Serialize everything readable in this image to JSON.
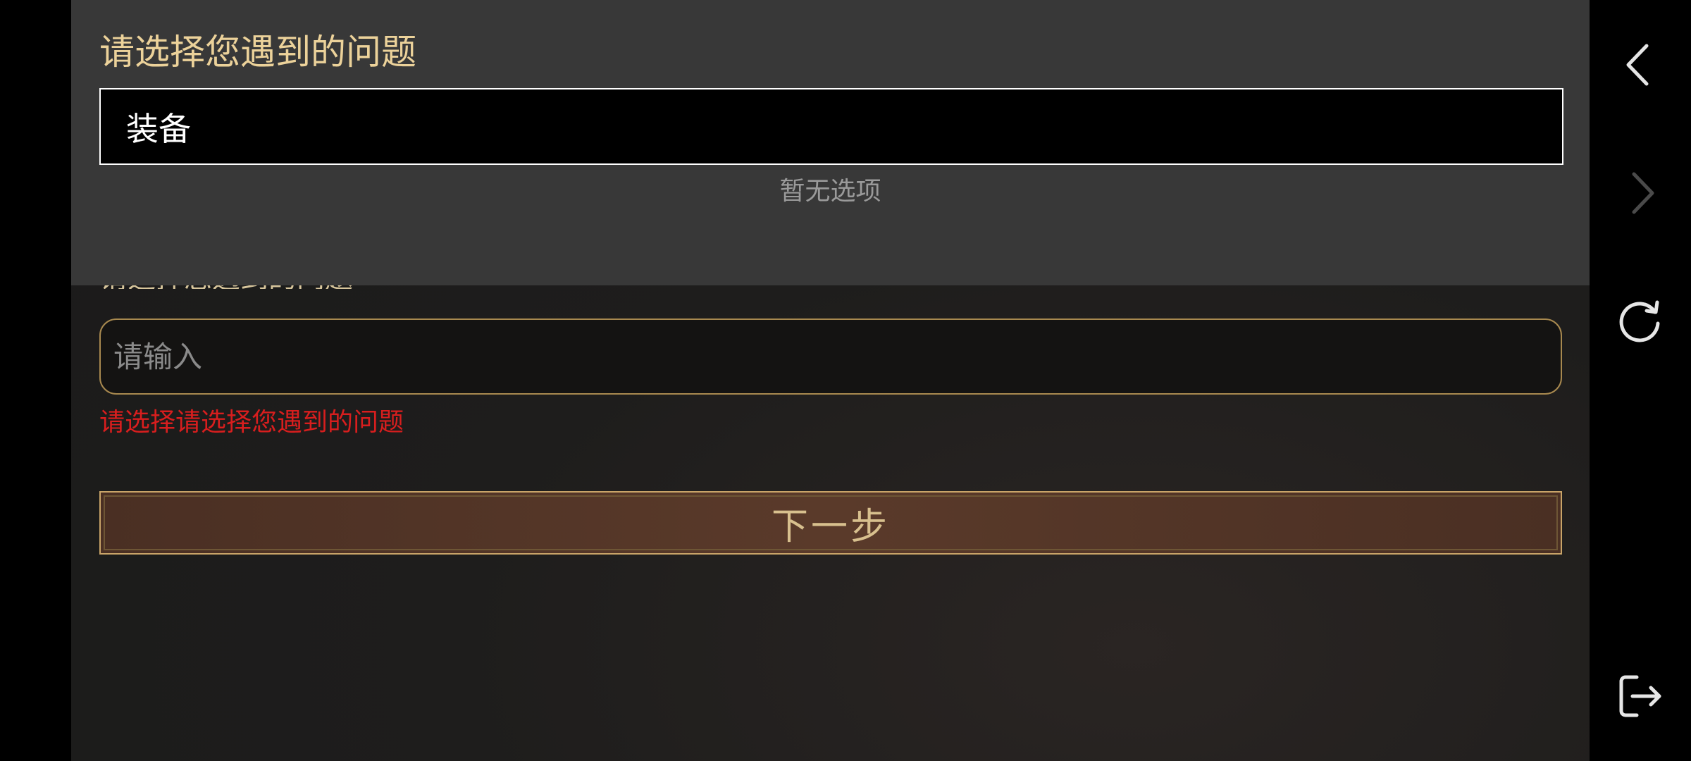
{
  "dropdown": {
    "title": "请选择您遇到的问题",
    "selected_value": "装备",
    "empty_text": "暂无选项"
  },
  "form": {
    "hidden_label": "请选择您遇到的问题",
    "input_placeholder": "请输入",
    "input_value": "",
    "error_message": "请选择请选择您遇到的问题",
    "next_label": "下一步"
  },
  "side_nav": {
    "items": [
      {
        "icon": "chevron-left-icon",
        "enabled": true
      },
      {
        "icon": "chevron-right-icon",
        "enabled": false
      },
      {
        "icon": "refresh-icon",
        "enabled": true
      },
      {
        "icon": "exit-icon",
        "enabled": true
      }
    ]
  },
  "colors": {
    "accent_gold": "#ecd29a",
    "error_red": "#d81e1e",
    "panel_gray": "#383838",
    "button_brown": "#4a2f23"
  }
}
